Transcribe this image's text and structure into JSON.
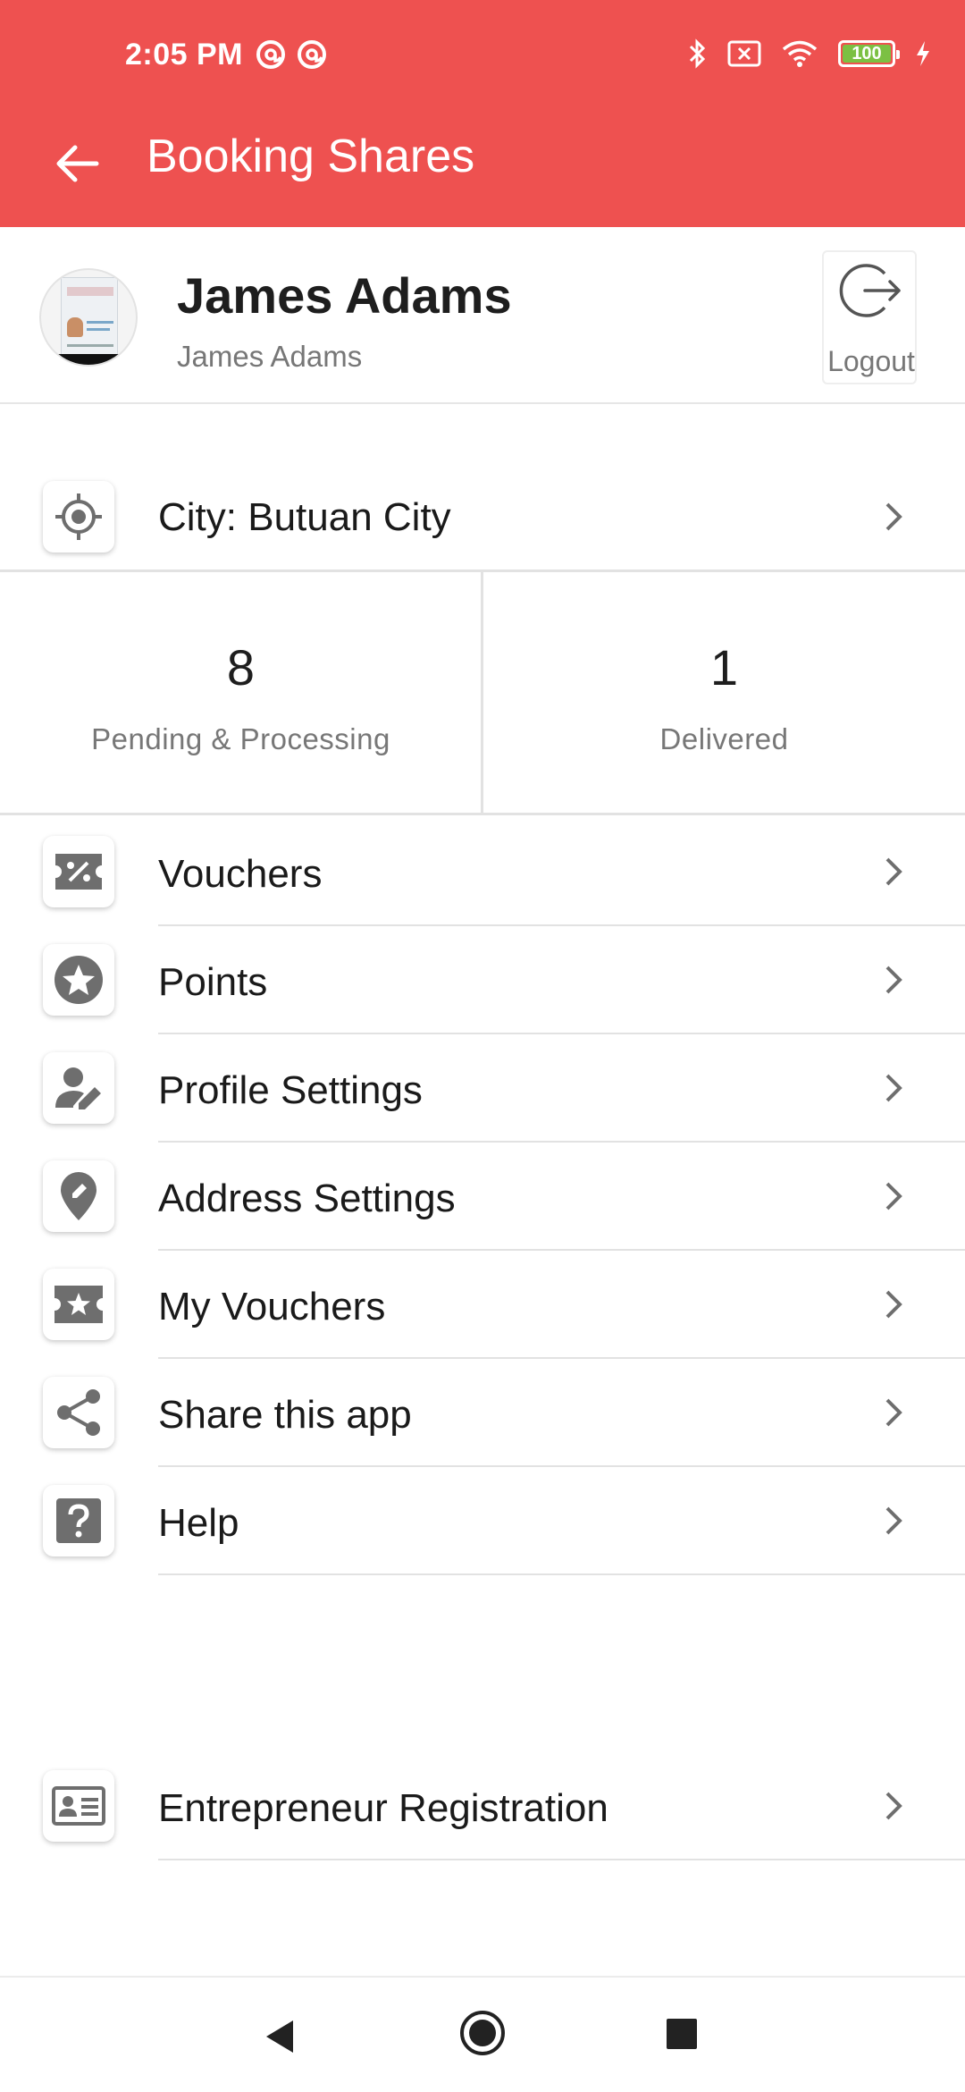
{
  "status_bar": {
    "time": "2:05 PM",
    "battery": "100"
  },
  "app_bar": {
    "title": "Booking Shares"
  },
  "profile": {
    "name": "James Adams",
    "subtitle": "James Adams",
    "logout_label": "Logout"
  },
  "city": {
    "label": "City:  Butuan City"
  },
  "stats": [
    {
      "value": "8",
      "label": "Pending & Processing"
    },
    {
      "value": "1",
      "label": "Delivered"
    }
  ],
  "menu": [
    {
      "label": "Vouchers",
      "icon": "voucher-percent-icon"
    },
    {
      "label": "Points",
      "icon": "star-circle-icon"
    },
    {
      "label": "Profile Settings",
      "icon": "user-edit-icon"
    },
    {
      "label": "Address Settings",
      "icon": "location-edit-icon"
    },
    {
      "label": "My Vouchers",
      "icon": "ticket-star-icon"
    },
    {
      "label": "Share this app",
      "icon": "share-icon"
    },
    {
      "label": "Help",
      "icon": "help-icon"
    }
  ],
  "entrepreneur": {
    "label": "Entrepreneur Registration",
    "icon": "id-card-icon"
  },
  "colors": {
    "header": "#ee5150",
    "icon_gray": "#6e6e6e",
    "text": "#1a1a1a",
    "muted": "#777777"
  }
}
